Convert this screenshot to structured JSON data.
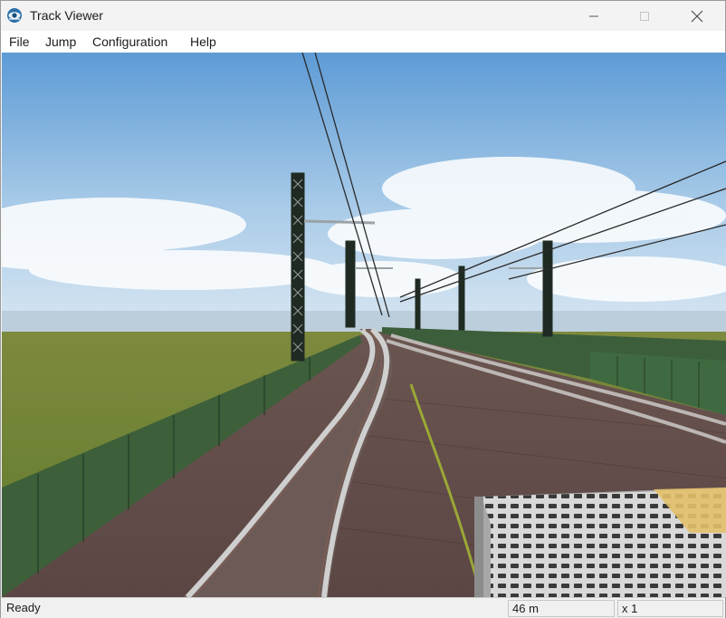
{
  "window": {
    "title": "Track Viewer"
  },
  "menu": {
    "items": [
      "File",
      "Jump",
      "Configuration",
      "Help"
    ]
  },
  "status": {
    "message": "Ready",
    "distance": "46 m",
    "speed": "x 1"
  }
}
